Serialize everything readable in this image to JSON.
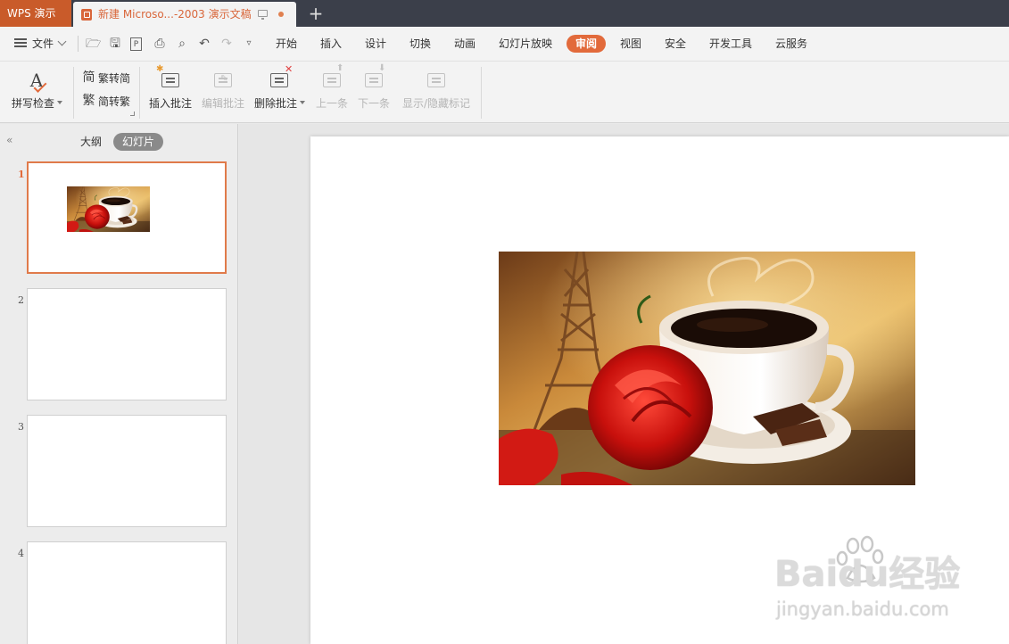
{
  "titlebar": {
    "app_name": "WPS 演示",
    "doc_title": "新建 Microso...-2003 演示文稿"
  },
  "menubar": {
    "file_label": "文件",
    "items": [
      "开始",
      "插入",
      "设计",
      "切换",
      "动画",
      "幻灯片放映",
      "审阅",
      "视图",
      "安全",
      "开发工具",
      "云服务"
    ],
    "active_item": "审阅"
  },
  "ribbon": {
    "spell_check": "拼写检查",
    "trad_to_simp": "繁转简",
    "simp_to_trad": "简转繁",
    "insert_comment": "插入批注",
    "edit_comment": "编辑批注",
    "delete_comment": "删除批注",
    "prev_comment": "上一条",
    "next_comment": "下一条",
    "show_hide_markup": "显示/隐藏标记"
  },
  "left_panel": {
    "tab_outline": "大纲",
    "tab_slides": "幻灯片",
    "active_tab": "幻灯片",
    "slides": [
      {
        "number": "1",
        "selected": true,
        "has_image": true
      },
      {
        "number": "2",
        "selected": false,
        "has_image": false
      },
      {
        "number": "3",
        "selected": false,
        "has_image": false
      },
      {
        "number": "4",
        "selected": false,
        "has_image": false
      }
    ]
  },
  "watermark": {
    "brand": "Baidu经验",
    "url": "jingyan.baidu.com"
  },
  "colors": {
    "accent": "#e26a3b",
    "titlebar_bg": "#3b3f4a",
    "app_tab_bg": "#c95b2a"
  }
}
